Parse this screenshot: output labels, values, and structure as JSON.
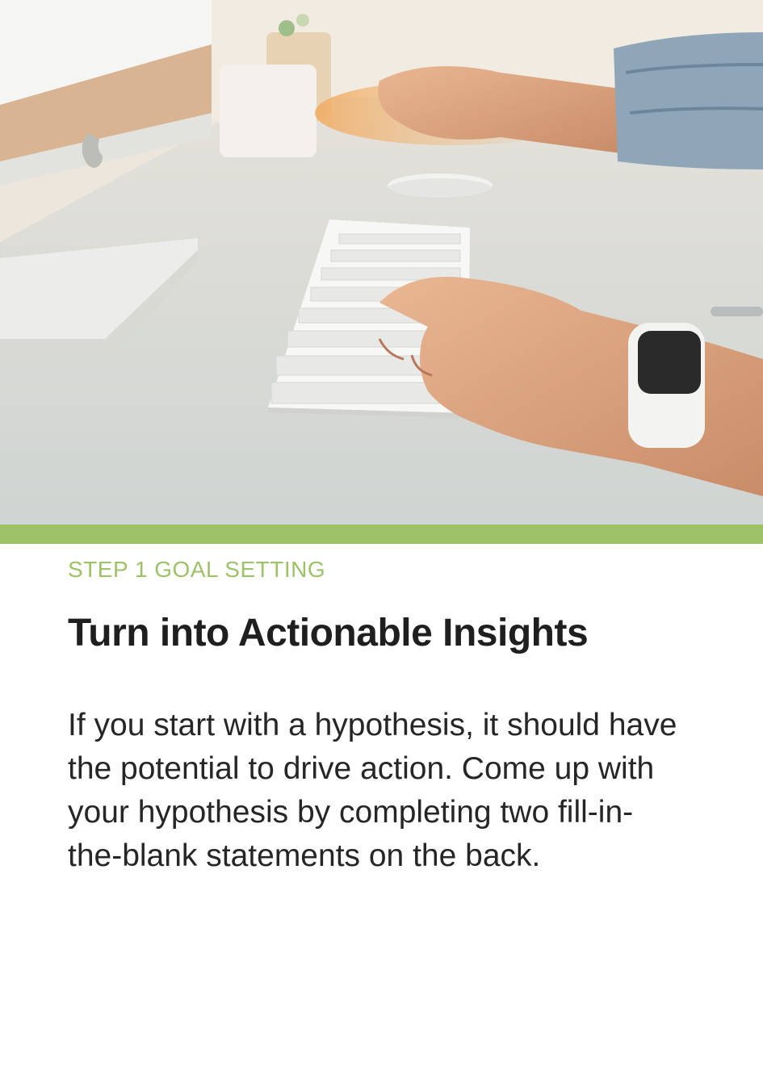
{
  "colors": {
    "accent": "#9ec268",
    "eyebrow": "#9ec268",
    "title": "#1f1f1f",
    "body": "#262626",
    "background": "#ffffff"
  },
  "hero_image": {
    "subject": "person-typing-on-keyboard-at-desk"
  },
  "card": {
    "eyebrow": "STEP 1 GOAL SETTING",
    "title": "Turn into Actionable Insights",
    "body": "If you start with a hypothesis, it should have the potential to drive action. Come up with your hypothesis by completing two fill-in-the-blank statements on the back."
  }
}
